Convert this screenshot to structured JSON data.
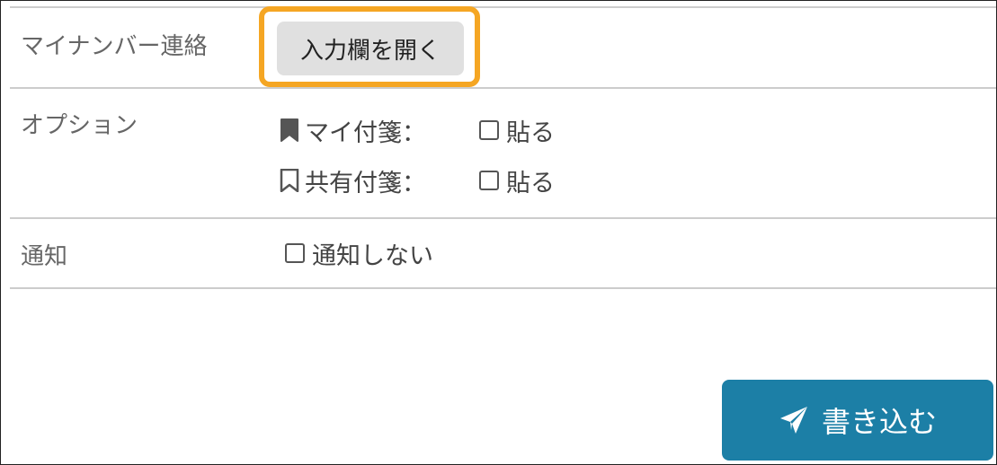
{
  "rows": {
    "mynumber": {
      "label": "マイナンバー連絡",
      "open_button_label": "入力欄を開く"
    },
    "options": {
      "label": "オプション",
      "my_sticky": {
        "label": "マイ付箋：",
        "checkbox_label": "貼る",
        "checked": false,
        "icon": "bookmark-filled-icon"
      },
      "shared_sticky": {
        "label": "共有付箋：",
        "checkbox_label": "貼る",
        "checked": false,
        "icon": "bookmark-outline-icon"
      }
    },
    "notify": {
      "label": "通知",
      "checkbox_label": "通知しない",
      "checked": false
    }
  },
  "submit": {
    "label": "書き込む",
    "icon": "paper-plane-icon"
  },
  "colors": {
    "highlight": "#f5a623",
    "submit_bg": "#1c7fa6",
    "divider": "#cccccc",
    "open_button_bg": "#e0e0e0"
  }
}
